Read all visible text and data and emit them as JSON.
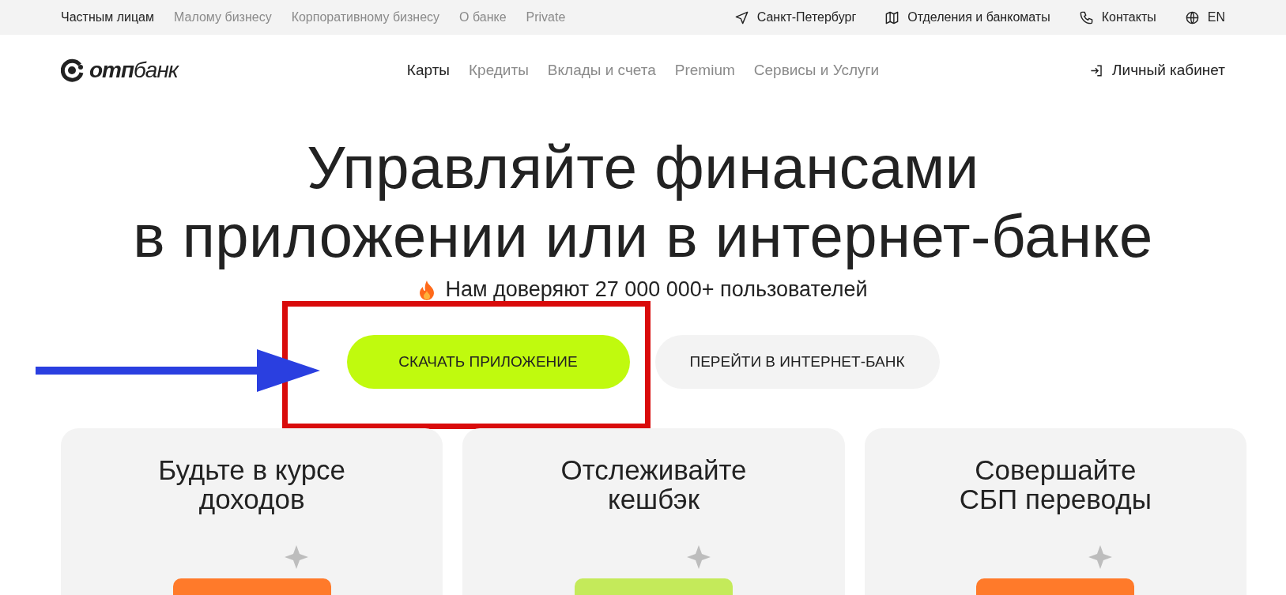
{
  "top_bar": {
    "segments": [
      {
        "label": "Частным лицам",
        "selected": true
      },
      {
        "label": "Малому бизнесу",
        "selected": false
      },
      {
        "label": "Корпоративному бизнесу",
        "selected": false
      },
      {
        "label": "О банке",
        "selected": false
      },
      {
        "label": "Private",
        "selected": false
      }
    ],
    "links": [
      {
        "kind": "location",
        "label": "Санкт-Петербург"
      },
      {
        "kind": "map",
        "label": "Отделения и банкоматы"
      },
      {
        "kind": "phone",
        "label": "Контакты"
      },
      {
        "kind": "language",
        "label": "EN"
      }
    ]
  },
  "header": {
    "logo": {
      "bold": "отп",
      "light": "банк"
    },
    "nav": [
      {
        "label": "Карты",
        "selected": true
      },
      {
        "label": "Кредиты",
        "selected": false
      },
      {
        "label": "Вклады и счета",
        "selected": false
      },
      {
        "label": "Premium",
        "selected": false
      },
      {
        "label": "Сервисы и Услуги",
        "selected": false
      }
    ],
    "account_link": "Личный кабинет"
  },
  "hero": {
    "title_lines": [
      "Управляйте финансами",
      "в приложении или в интернет-банке"
    ],
    "trust_line": "Нам доверяют 27 000 000+ пользователей",
    "buttons": [
      {
        "kind": "primary",
        "label": "СКАЧАТЬ ПРИЛОЖЕНИЕ"
      },
      {
        "kind": "secondary",
        "label": "ПЕРЕЙТИ В ИНТЕРНЕТ-БАНК"
      }
    ]
  },
  "cards": [
    {
      "title_lines": [
        "Будьте в курсе",
        "доходов"
      ],
      "kind": "orange"
    },
    {
      "title_lines": [
        "Отслеживайте",
        "кешбэк"
      ],
      "kind": "green"
    },
    {
      "title_lines": [
        "Совершайте",
        "СБП переводы"
      ],
      "kind": "orange"
    }
  ]
}
